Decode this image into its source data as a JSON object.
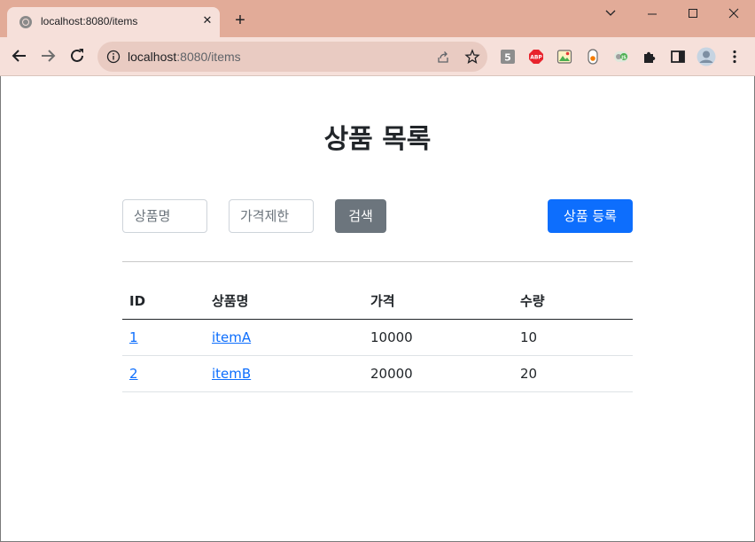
{
  "browser": {
    "tab_title": "localhost:8080/items",
    "url_host": "localhost",
    "url_rest": ":8080/items",
    "new_tab": "+",
    "tab_close": "✕"
  },
  "page": {
    "title": "상품 목록",
    "search": {
      "name_placeholder": "상품명",
      "price_placeholder": "가격제한",
      "search_label": "검색"
    },
    "add_label": "상품 등록",
    "table": {
      "headers": [
        "ID",
        "상품명",
        "가격",
        "수량"
      ],
      "rows": [
        {
          "id": "1",
          "name": "itemA",
          "price": "10000",
          "quantity": "10"
        },
        {
          "id": "2",
          "name": "itemB",
          "price": "20000",
          "quantity": "20"
        }
      ]
    }
  },
  "colors": {
    "titlebar": "#e2ab98",
    "toolbar": "#f6e0da",
    "primary": "#0d6efd",
    "secondary": "#6c757d"
  },
  "icons": [
    "globe-icon",
    "close-icon",
    "plus-icon",
    "chevron-down-icon",
    "minimize-icon",
    "maximize-icon",
    "close-window-icon",
    "back-arrow-icon",
    "forward-arrow-icon",
    "reload-icon",
    "info-icon",
    "share-icon",
    "star-icon",
    "html5-extension-icon",
    "adblock-plus-icon",
    "image-extension-icon",
    "capsule-extension-icon",
    "js-extension-icon",
    "puzzle-icon",
    "side-panel-icon",
    "profile-avatar-icon",
    "more-menu-icon"
  ]
}
